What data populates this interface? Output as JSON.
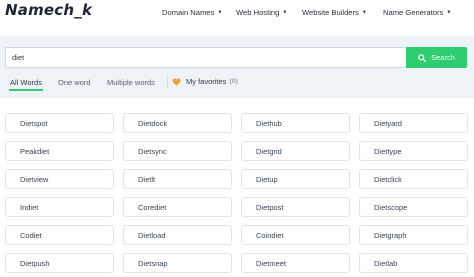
{
  "header": {
    "logo": "Namech_k",
    "nav": [
      {
        "label": "Domain Names"
      },
      {
        "label": "Web Hosting"
      },
      {
        "label": "Website Builders"
      },
      {
        "label": "Name Generators"
      }
    ]
  },
  "search": {
    "value": "diet",
    "button_label": "Search"
  },
  "tabs": [
    {
      "label": "All Words",
      "active": true
    },
    {
      "label": "One word",
      "active": false
    },
    {
      "label": "Multiple words",
      "active": false
    }
  ],
  "favorites": {
    "label": "My favorites",
    "count": "(0)"
  },
  "results": [
    [
      "Dietspot",
      "Dietdock",
      "Diethub",
      "Dietyard"
    ],
    [
      "Peakdiet",
      "Dietsync",
      "Dietgrid",
      "Diettype"
    ],
    [
      "Dietview",
      "Dietlt",
      "Dietup",
      "Dietclick"
    ],
    [
      "Indiet",
      "Corediet",
      "Dietpost",
      "Dietscope"
    ],
    [
      "Codiet",
      "Dietload",
      "Coindiet",
      "Dietgraph"
    ],
    [
      "Dietpush",
      "Dietsnap",
      "Dietmeet",
      "Dietlab"
    ]
  ],
  "colors": {
    "accent_green": "#2fcc71",
    "heart_orange": "#f0a03a",
    "band_background": "#eef3f7"
  }
}
